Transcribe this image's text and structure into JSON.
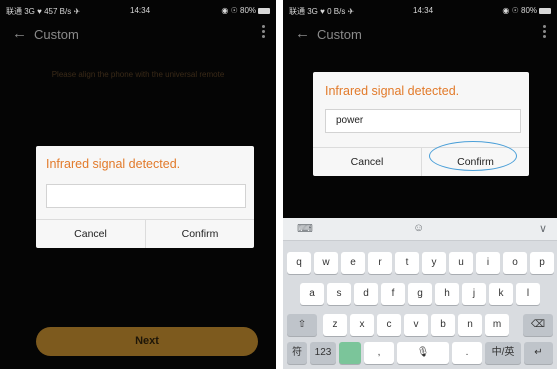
{
  "left_screen": {
    "status": {
      "left": "联通 3G ♥ 457 B/s ✈",
      "time": "14:34",
      "right": "◉ ☉ 80%"
    },
    "app_title": "Custom",
    "instruction": "Please align the phone with the universal remote",
    "dialog": {
      "title": "Infrared signal detected.",
      "input_value": "",
      "cancel_label": "Cancel",
      "confirm_label": "Confirm"
    },
    "next_label": "Next"
  },
  "right_screen": {
    "status": {
      "left": "联通 3G ♥ 0 B/s ✈",
      "time": "14:34",
      "right": "◉ ☉ 80%"
    },
    "app_title": "Custom",
    "dialog": {
      "title": "Infrared signal detected.",
      "input_value": "power",
      "cancel_label": "Cancel",
      "confirm_label": "Confirm"
    },
    "keyboard": {
      "toolbar": {
        "left_icon": "keyboard-icon",
        "center_icon": "emoji-icon",
        "right_icon": "collapse-icon"
      },
      "row1": [
        "q",
        "w",
        "e",
        "r",
        "t",
        "y",
        "u",
        "i",
        "o",
        "p"
      ],
      "row2": [
        "a",
        "s",
        "d",
        "f",
        "g",
        "h",
        "j",
        "k",
        "l"
      ],
      "row3": [
        "z",
        "x",
        "c",
        "v",
        "b",
        "n",
        "m"
      ],
      "row4": {
        "symbols": "符",
        "numbers": "123",
        "comma": ",",
        "period": ".",
        "lang": "中/英"
      }
    }
  },
  "colors": {
    "dialog_title": "#e27a2a",
    "next_button": "#7d5a1e",
    "confirm_highlight": "#4a9fd8"
  }
}
